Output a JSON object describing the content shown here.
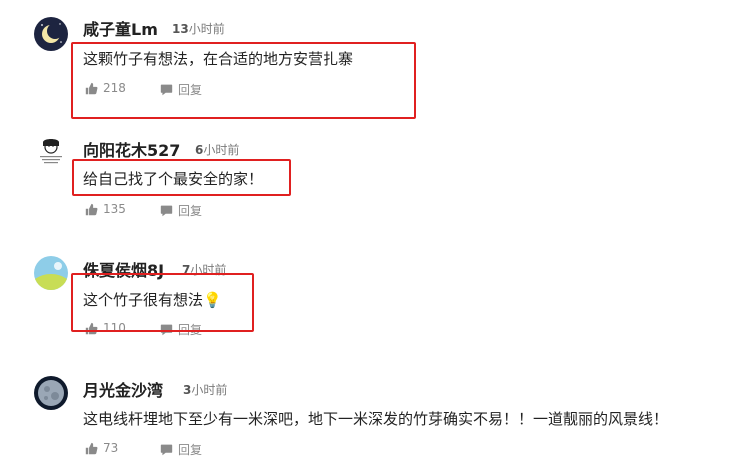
{
  "comments": [
    {
      "username": "咸子童Lm",
      "time_number": "13",
      "time_unit": "小时前",
      "text": "这颗竹子有想法，在合适的地方安营扎寨",
      "likes": "218",
      "reply_label": "回复",
      "highlighted": true
    },
    {
      "username": "向阳花木527",
      "time_number": "6",
      "time_unit": "小时前",
      "text": "给自己找了个最安全的家！",
      "likes": "135",
      "reply_label": "回复",
      "highlighted": true
    },
    {
      "username": "侏夏侯烟8J",
      "time_number": "7",
      "time_unit": "小时前",
      "text": "这个竹子很有想法💡",
      "likes": "110",
      "reply_label": "回复",
      "highlighted": true
    },
    {
      "username": "月光金沙湾",
      "time_number": "3",
      "time_unit": "小时前",
      "text": "这电线杆埋地下至少有一米深吧，地下一米深发的竹芽确实不易！！一道靓丽的风景线！",
      "likes": "73",
      "reply_label": "回复",
      "highlighted": false
    }
  ],
  "colors": {
    "highlight_border": "#e02020",
    "meta_text": "#8a8a8a"
  },
  "icons": {
    "like": "thumbs-up-icon",
    "reply": "speech-bubble-icon"
  }
}
